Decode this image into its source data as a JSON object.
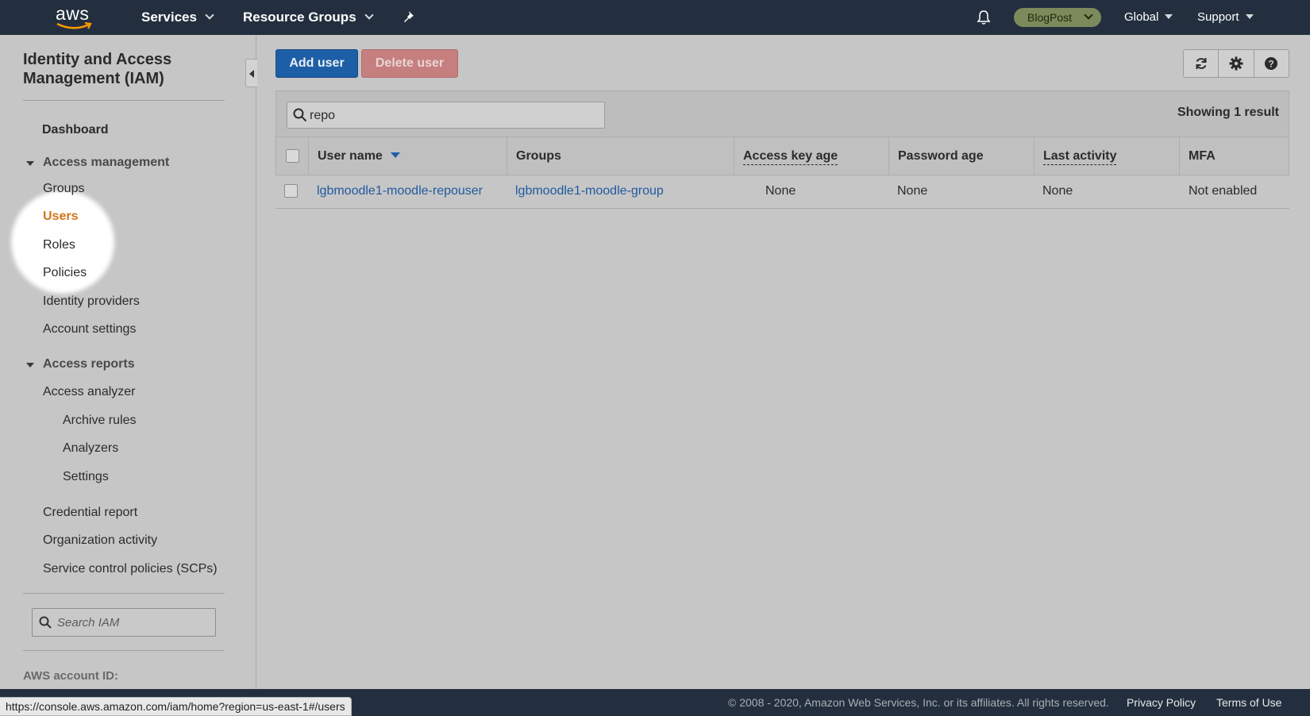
{
  "topnav": {
    "logo": "aws",
    "services": "Services",
    "resource_groups": "Resource Groups",
    "pin_icon": "pin-icon",
    "bell_icon": "bell-icon",
    "account": "BlogPost",
    "region": "Global",
    "support": "Support"
  },
  "sidebar": {
    "title": "Identity and Access Management (IAM)",
    "dashboard": "Dashboard",
    "access_management": "Access management",
    "am_items": [
      "Groups",
      "Users",
      "Roles",
      "Policies",
      "Identity providers",
      "Account settings"
    ],
    "active_item": "Users",
    "access_reports": "Access reports",
    "ar_items": [
      "Access analyzer",
      "Credential report",
      "Organization activity",
      "Service control policies (SCPs)"
    ],
    "analyzer_subitems": [
      "Archive rules",
      "Analyzers",
      "Settings"
    ],
    "search_placeholder": "Search IAM",
    "account_id_label": "AWS account ID:"
  },
  "toolbar": {
    "add_user": "Add user",
    "delete_user": "Delete user",
    "icons": [
      "refresh-icon",
      "gear-icon",
      "help-icon"
    ]
  },
  "table": {
    "search_value": "repo",
    "showing": "Showing 1 result",
    "columns": [
      "User name",
      "Groups",
      "Access key age",
      "Password age",
      "Last activity",
      "MFA"
    ],
    "rows": [
      {
        "user_name": "lgbmoodle1-moodle-repouser",
        "groups": "lgbmoodle1-moodle-group",
        "access_key_age": "None",
        "password_age": "None",
        "last_activity": "None",
        "mfa": "Not enabled"
      }
    ]
  },
  "footer": {
    "copyright": "© 2008 - 2020, Amazon Web Services, Inc. or its affiliates. All rights reserved.",
    "privacy": "Privacy Policy",
    "terms": "Terms of Use",
    "status_url": "https://console.aws.amazon.com/iam/home?region=us-east-1#/users"
  },
  "colors": {
    "nav_bg": "#232f3e",
    "primary": "#1d5fa6",
    "active": "#d5741a",
    "link": "#1f5a9f"
  }
}
